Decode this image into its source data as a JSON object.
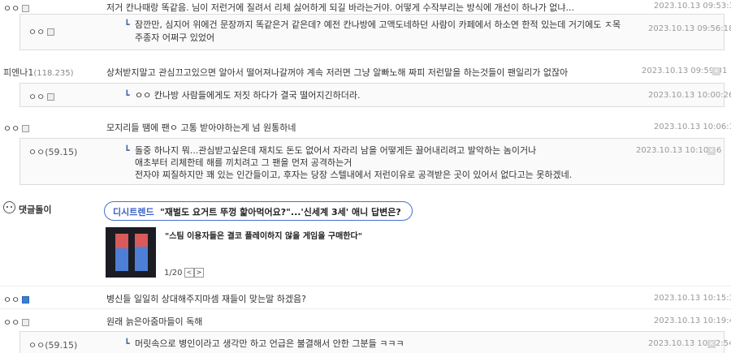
{
  "comments": [
    {
      "nick": "ㅇㅇ",
      "ip": "",
      "text": "저거 칸나때랑 똑같음. 님이 저런거에 질려서 리체 싫어하게 되길 바라는거야. 어떻게 수작부리는 방식에 개선이 하나가 없냐...",
      "date": "2023.10.13 09:53:31"
    },
    {
      "nick": "ㅇㅇ",
      "ip": "",
      "text_line1": "잠깐만, 심지어 위에건 문장까지 똑같은거 같은데? 예전 칸나방에 고액도네하던 사람이 카페에서 하소연 한적 있는데 거기에도 ㅈ목",
      "text_line2": "주종자 어쩌구 있었어",
      "date": "2023.10.13 09:56:18"
    },
    {
      "nick": "피엔나1",
      "ip": "(118.235)",
      "text": "상처받지말고 관심끄고있으면 알아서 떨어져나갈꺼야 계속 저러면 그냥 알빠노해 짜피 저런말을 하는것들이 팬일리가 없잖아",
      "date": "2023.10.13 09:59:31"
    },
    {
      "nick": "ㅇㅇ",
      "ip": "",
      "text": "ㅇㅇ 칸나방 사람들에게도 저짓 하다가 결국 떨어지긴하더라.",
      "date": "2023.10.13 10:00:26"
    },
    {
      "nick": "ㅇㅇ",
      "ip": "",
      "text": "모지리들 땜에 팬ㅇ 고통 받아야하는게 넘 원통하네",
      "date": "2023.10.13 10:06:19"
    },
    {
      "nick": "ㅇㅇ",
      "ip": "(59.15)",
      "text_line1": "돌중 하나지 뭐...관심받고싶은데 재치도 돈도 없어서 자라리 남을 어떻게든 끌어내리려고 발악하는 놈이거나",
      "text_line2": "애초부터 리체한테 해를 끼치려고 그 팬을 먼저 공격하는거",
      "text_line3": "전자야 찌질하지만 꽤 있는 인간들이고, 후자는 당장 스텔내에서 저런이유로 공격받은 곳이 있어서 없다고는 못하겠네.",
      "date": "2023.10.13 10:10:46"
    },
    {
      "nick": "ㅇㅇ",
      "ip": "",
      "text": "병신들 일일히 상대해주지마셈 재들이 맞는말 하겠음?",
      "date": "2023.10.13 10:15:36"
    },
    {
      "nick": "ㅇㅇ",
      "ip": "",
      "text": "원래 늙은아줌마들이 독해",
      "date": "2023.10.13 10:19:42"
    },
    {
      "nick": "ㅇㅇ",
      "ip": "(59.15)",
      "text": "머릿속으로 병인이라고 생각만 하고 언급은 불결해서 안한 그분들 ㅋㅋㅋ",
      "date": "2023.10.13 10:22:54"
    }
  ],
  "promo": {
    "bot_label": "댓글돌이",
    "tag": "디시트렌드",
    "headline": "\"재벌도 요거트 뚜껑 핥아먹어요?\"...'신세계 3세' 애니 답변은?",
    "subheadline": "\"스팀 이용자들은 결코 플레이하지 않을 게임을 구매한다\"",
    "page": "1/20",
    "prev": "<",
    "next": ">"
  },
  "colors": {
    "tag_blue": "#3b5fc7",
    "pill_border": "#4a6fd0",
    "reply_bg": "#fafafa"
  },
  "icons": {
    "delete": "close-icon",
    "image": "image-icon",
    "arrow": "reply-arrow-icon"
  }
}
